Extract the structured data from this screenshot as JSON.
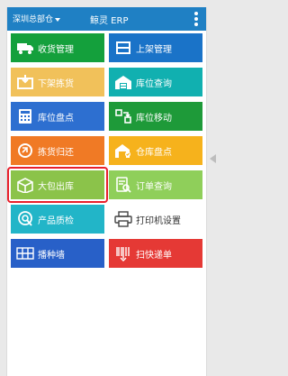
{
  "header": {
    "warehouse": "深圳总部仓",
    "title": "鲸灵 ERP"
  },
  "tiles": [
    {
      "label": "收货管理",
      "color": "#14a03c",
      "icon": "truck-icon"
    },
    {
      "label": "上架管理",
      "color": "#1a73c8",
      "icon": "shelving-icon"
    },
    {
      "label": "下架拣货",
      "color": "#f1c15a",
      "icon": "box-down-icon"
    },
    {
      "label": "库位查询",
      "color": "#11b0b0",
      "icon": "warehouse-icon"
    },
    {
      "label": "库位盘点",
      "color": "#2d6fd0",
      "icon": "calculator-icon"
    },
    {
      "label": "库位移动",
      "color": "#1e9a39",
      "icon": "move-icon"
    },
    {
      "label": "拣货归还",
      "color": "#f07a25",
      "icon": "return-icon"
    },
    {
      "label": "仓库盘点",
      "color": "#f6b21c",
      "icon": "warehouse-check-icon"
    },
    {
      "label": "大包出库",
      "color": "#8bc34a",
      "icon": "package-out-icon"
    },
    {
      "label": "订单查询",
      "color": "#8fcf5a",
      "icon": "order-search-icon"
    },
    {
      "label": "产品质检",
      "color": "#22b5c8",
      "icon": "quality-check-icon"
    },
    {
      "label": "打印机设置",
      "color": "#ffffff",
      "icon": "printer-icon"
    },
    {
      "label": "播种墙",
      "color": "#2860c8",
      "icon": "seeding-wall-icon"
    },
    {
      "label": "扫快递单",
      "color": "#e53935",
      "icon": "barcode-icon"
    }
  ],
  "highlight_color": "#e8202c"
}
